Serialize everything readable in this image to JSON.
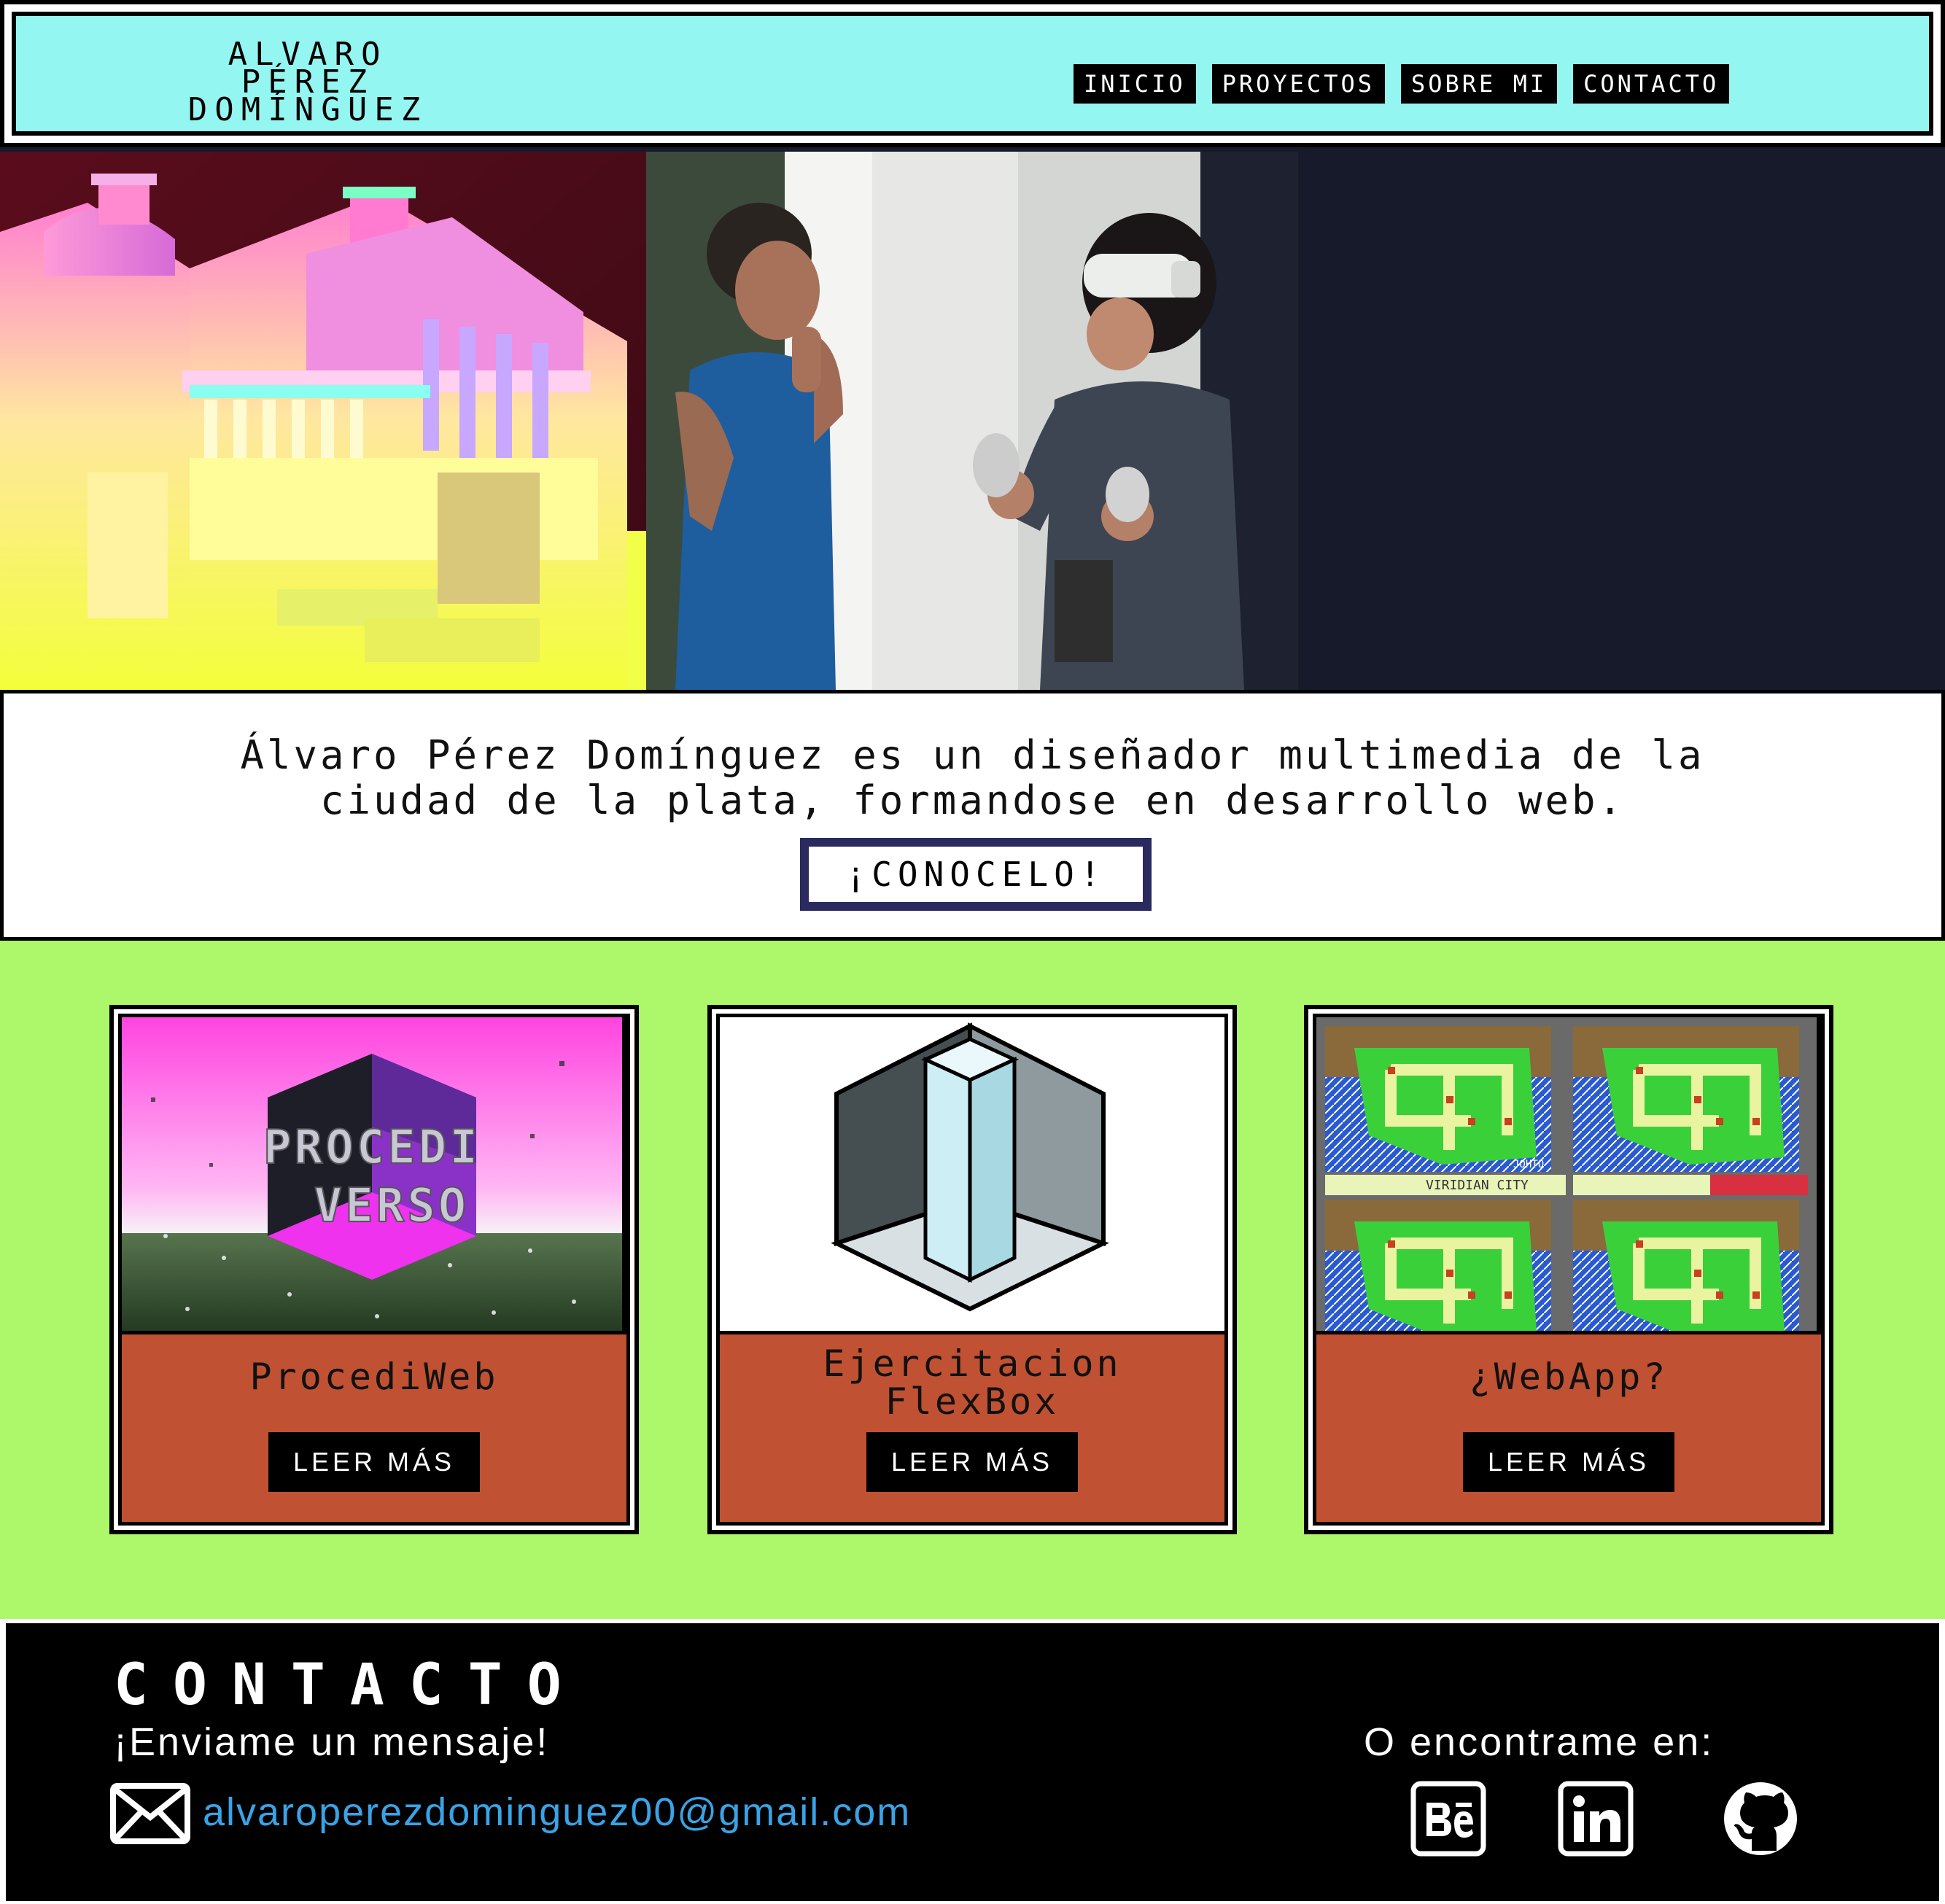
{
  "header": {
    "logo_lines": [
      "ALVARO",
      "PÉREZ",
      "DOMÍNGUEZ"
    ],
    "nav": [
      "INICIO",
      "PROYECTOS",
      "SOBRE MI",
      "CONTACTO"
    ]
  },
  "intro": {
    "text_line1": "Álvaro Pérez Domínguez es un diseñador multimedia de la",
    "text_line2": "ciudad de la plata, formandose en desarrollo web.",
    "cta": "¡CONOCELO!"
  },
  "projects": [
    {
      "title": "ProcediWeb",
      "button": "LEER MÁS",
      "image_text": [
        "PROCEDI",
        "VERSO"
      ]
    },
    {
      "title_line1": "Ejercitacion",
      "title_line2": "FlexBox",
      "button": "LEER MÁS"
    },
    {
      "title": "¿WebApp?",
      "button": "LEER MÁS",
      "map_labels": [
        "JOHTO",
        "VIRIDIAN CITY"
      ]
    }
  ],
  "footer": {
    "title": "CONTACTO",
    "message": "¡Enviame un mensaje!",
    "find": "O encontrame en:",
    "email": "alvaroperezdominguez00@gmail.com",
    "social_icons": [
      "behance-icon",
      "linkedin-icon",
      "github-icon"
    ]
  },
  "colors": {
    "header_bg": "#94f6f0",
    "projects_bg": "#adf76a",
    "card_body": "#c05133",
    "email": "#3aa3e6",
    "hero_dark": "#161a2b"
  }
}
